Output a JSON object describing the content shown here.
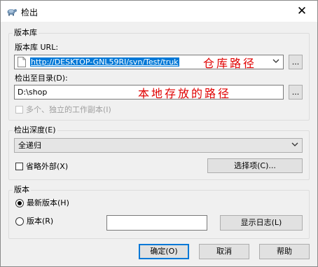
{
  "window": {
    "title": "检出",
    "close_glyph": "✕"
  },
  "repository": {
    "group_label": "版本库",
    "url_label": "版本库 URL:",
    "url_value": "http://DESKTOP-GNL59RI/svn/Test/truk",
    "url_annotation": "仓库路径",
    "browse_label": "...",
    "dir_label": "检出至目录(D):",
    "dir_value": "D:\\shop",
    "dir_annotation": "本地存放的路径",
    "dir_browse_label": "...",
    "multiple_copies_label": "多个、独立的工作副本(I)",
    "multiple_copies_checked": false
  },
  "depth": {
    "group_label": "检出深度(E)",
    "selected": "全递归",
    "omit_externals_label": "省略外部(X)",
    "omit_externals_checked": false,
    "choose_items_label": "选择项(C)..."
  },
  "revision": {
    "group_label": "版本",
    "head_label": "最新版本(H)",
    "head_selected": true,
    "revision_label": "版本(R)",
    "revision_value": "",
    "show_log_label": "显示日志(L)"
  },
  "footer": {
    "ok_label": "确定(O)",
    "cancel_label": "取消",
    "help_label": "帮助"
  },
  "colors": {
    "accent": "#0078d7",
    "annotation": "#e00000"
  }
}
